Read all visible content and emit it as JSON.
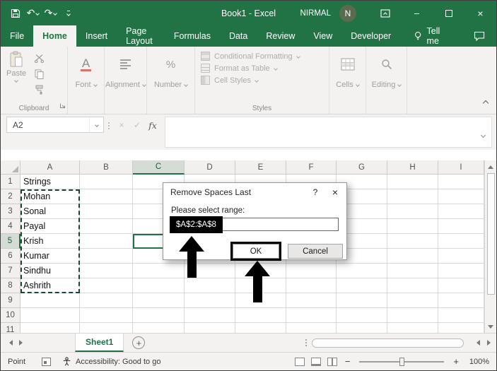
{
  "titlebar": {
    "title": "Book1  -  Excel",
    "user_name": "NIRMAL",
    "avatar_initial": "N",
    "undo_icon": "↶",
    "redo_icon": "↷",
    "minimize_icon": "−",
    "close_icon": "×"
  },
  "ribbon_tabs": {
    "items": [
      "File",
      "Home",
      "Insert",
      "Page Layout",
      "Formulas",
      "Data",
      "Review",
      "View",
      "Developer"
    ],
    "active": "Home",
    "tell_me": "Tell me"
  },
  "ribbon": {
    "paste_label": "Paste",
    "clipboard_group": "Clipboard",
    "font_icon_letter": "A",
    "font_group": "Font",
    "alignment_group": "Alignment",
    "number_icon": "%",
    "number_group": "Number",
    "styles_items": [
      "Conditional Formatting",
      "Format as Table",
      "Cell Styles"
    ],
    "styles_group": "Styles",
    "cells_group": "Cells",
    "editing_group": "Editing"
  },
  "formula_bar": {
    "name_box": "A2",
    "cancel_icon": "×",
    "enter_icon": "✓",
    "fx_icon": "fx"
  },
  "grid": {
    "col_headers": [
      "A",
      "B",
      "C",
      "D",
      "E",
      "F",
      "G",
      "H",
      "I"
    ],
    "row_headers": [
      "1",
      "2",
      "3",
      "4",
      "5",
      "6",
      "7",
      "8",
      "9",
      "10",
      "11"
    ],
    "cells": {
      "A1": "Strings",
      "A2": "Mohan",
      "A3": "Sonal",
      "A4": "Payal",
      "A5": "Krish",
      "A6": "Kumar",
      "A7": "Sindhu",
      "A8": "Ashrith"
    },
    "selected_range": "A2:A8",
    "outlined_cell": "C5",
    "active_col": "C",
    "active_row": "5"
  },
  "dialog": {
    "title": "Remove Spaces Last",
    "help_icon": "?",
    "close_icon": "×",
    "prompt": "Please select range:",
    "range_value": "$A$2:$A$8",
    "ok_label": "OK",
    "cancel_label": "Cancel"
  },
  "sheetbar": {
    "sheet_name": "Sheet1",
    "add_icon": "+"
  },
  "statusbar": {
    "mode": "Point",
    "accessibility": "Accessibility: Good to go",
    "zoom_out": "−",
    "zoom_in": "+",
    "zoom_level": "100%"
  },
  "colors": {
    "excel_green": "#217346",
    "annotation_black": "#000000"
  }
}
